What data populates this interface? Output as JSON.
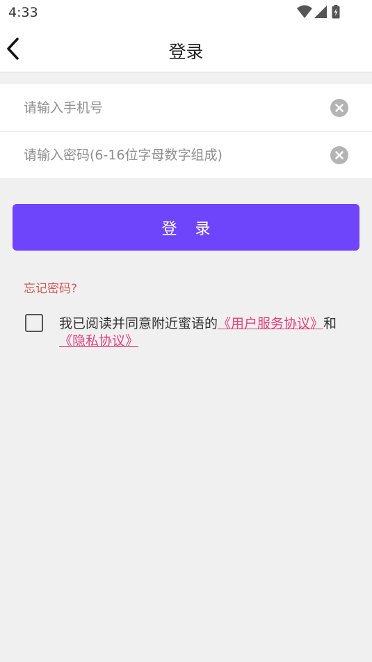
{
  "status_bar": {
    "time": "4:33",
    "icons": [
      "wifi-icon",
      "signal-icon",
      "battery-icon"
    ]
  },
  "header": {
    "back_icon": "chevron-left-icon",
    "title": "登录"
  },
  "form": {
    "phone": {
      "value": "",
      "placeholder": "请输入手机号",
      "clear_icon": "clear-circle-icon"
    },
    "password": {
      "value": "",
      "placeholder": "请输入密码(6-16位字母数字组成)",
      "clear_icon": "clear-circle-icon"
    }
  },
  "login_button": {
    "label": "登录"
  },
  "forgot_password": {
    "label": "忘记密码?"
  },
  "agreement": {
    "checked": false,
    "prefix": "我已阅读并同意附近蜜语的",
    "user_agreement": "《用户服务协议》",
    "connector": "和",
    "privacy_agreement": "《隐私协议》"
  },
  "colors": {
    "primary": "#6f45fc",
    "link": "#e0427a",
    "forgot": "#d05a5a",
    "background": "#f0f0f0"
  }
}
